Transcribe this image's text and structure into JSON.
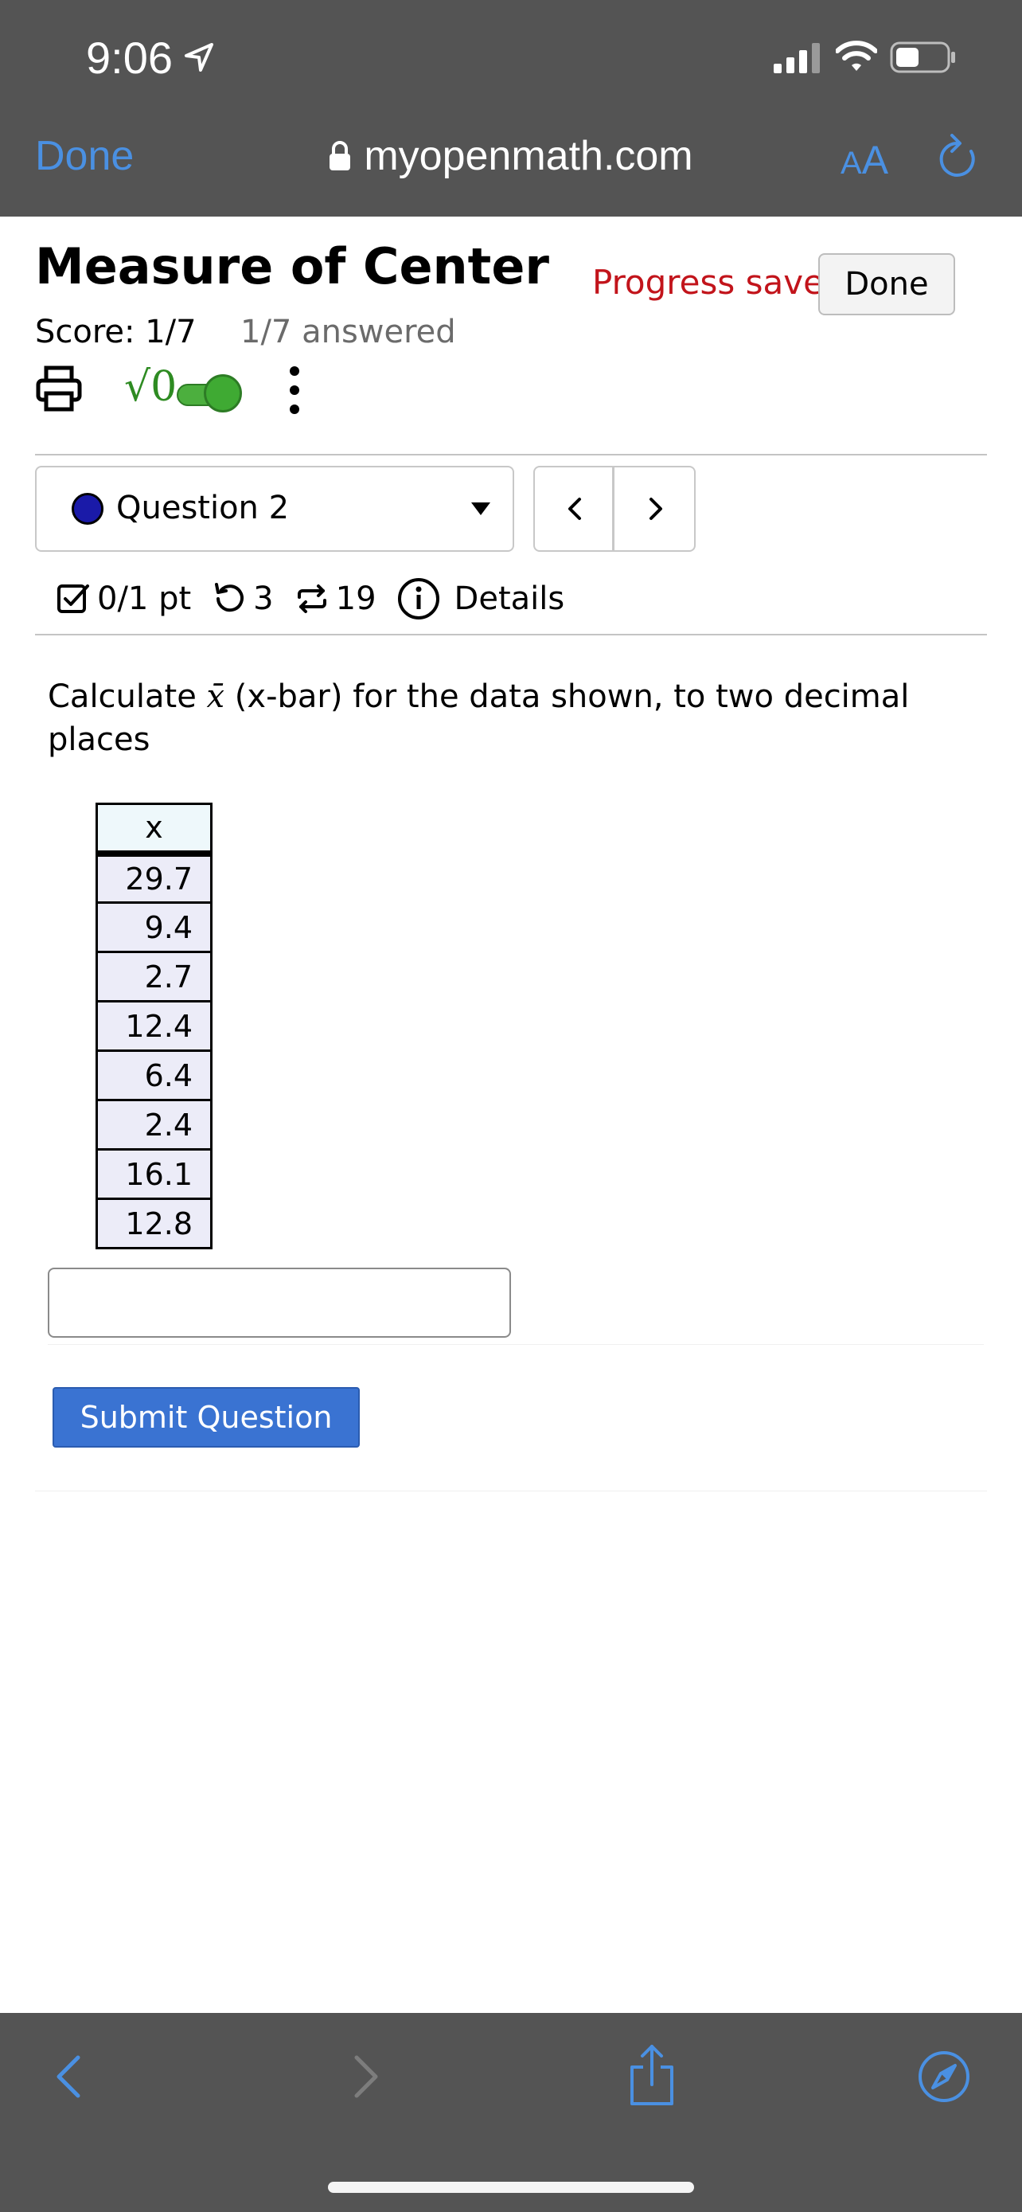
{
  "status_bar": {
    "time": "9:06",
    "icons": [
      "location-arrow-icon",
      "cellular-signal-icon",
      "wifi-icon",
      "battery-icon"
    ]
  },
  "safari": {
    "done_label": "Done",
    "url": "myopenmath.com",
    "text_size_label_small": "A",
    "text_size_label_big": "A",
    "accent_color": "#4a90e2",
    "toolbar_icons": [
      "back-icon",
      "forward-icon",
      "share-icon",
      "compass-icon"
    ]
  },
  "assessment": {
    "title": "Measure of Center",
    "progress_status": "Progress saved",
    "done_label": "Done",
    "score": "Score: 1/7",
    "answered": "1/7 answered"
  },
  "tools": {
    "math_entry_label": "√0"
  },
  "question_nav": {
    "selected": "Question 2",
    "prev_label": "<",
    "next_label": ">"
  },
  "question_meta": {
    "points": "0/1 pt",
    "retries": "3",
    "versions": "19",
    "details_label": "Details"
  },
  "question": {
    "prompt_before": "Calculate ",
    "prompt_symbol": "x̄",
    "prompt_after": " (x-bar) for the data shown, to two decimal places",
    "table_header": "x",
    "values": [
      "29.7",
      "9.4",
      "2.7",
      "12.4",
      "6.4",
      "2.4",
      "16.1",
      "12.8"
    ],
    "answer_value": "",
    "submit_label": "Submit Question"
  },
  "colors": {
    "chrome_bg": "#545454",
    "progress_saved": "#c2141b",
    "submit_button": "#3a73d2",
    "toggle_on": "#3faa33"
  }
}
